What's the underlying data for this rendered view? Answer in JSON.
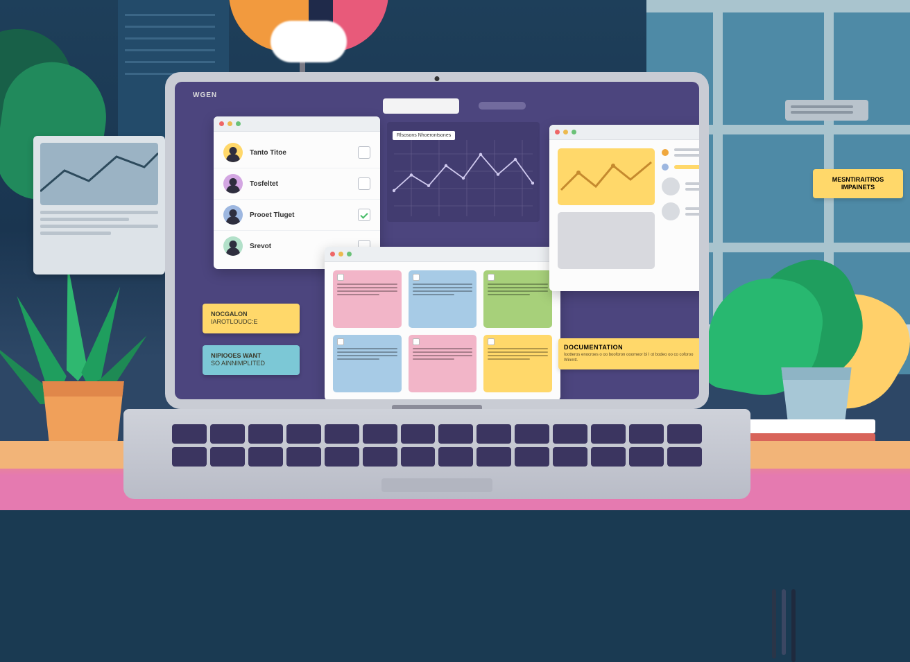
{
  "brand": "WGEN",
  "team_panel": {
    "rows": [
      {
        "name": "Tanto Titoe",
        "checked": false
      },
      {
        "name": "Tosfeltet",
        "checked": false
      },
      {
        "name": "Prooet Tluget",
        "checked": true
      },
      {
        "name": "Srevot",
        "checked": false
      }
    ]
  },
  "chart_panel": {
    "title": "Rlsosons Nhoerontsones"
  },
  "left_notes": [
    {
      "title": "NOCGALON",
      "subtitle": "IAROTLOUDC:E"
    },
    {
      "title": "NIPIOOES WANT",
      "subtitle": "SO AINNIMPLITED"
    }
  ],
  "right_note": {
    "line1": "MESNTIRAITROS",
    "line2": "IMPAINETS"
  },
  "doc_card": {
    "title": "DOCUMENTATION",
    "subtitle": "Iootteros enocroes o oo booforon ooomeor bi I ot bodeo oo co coforoo Winmtt."
  },
  "chart_data": {
    "type": "line",
    "x": [
      0,
      1,
      2,
      3,
      4,
      5,
      6,
      7,
      8
    ],
    "values": [
      30,
      55,
      38,
      70,
      50,
      88,
      56,
      80,
      42
    ],
    "ylim": [
      0,
      100
    ]
  }
}
